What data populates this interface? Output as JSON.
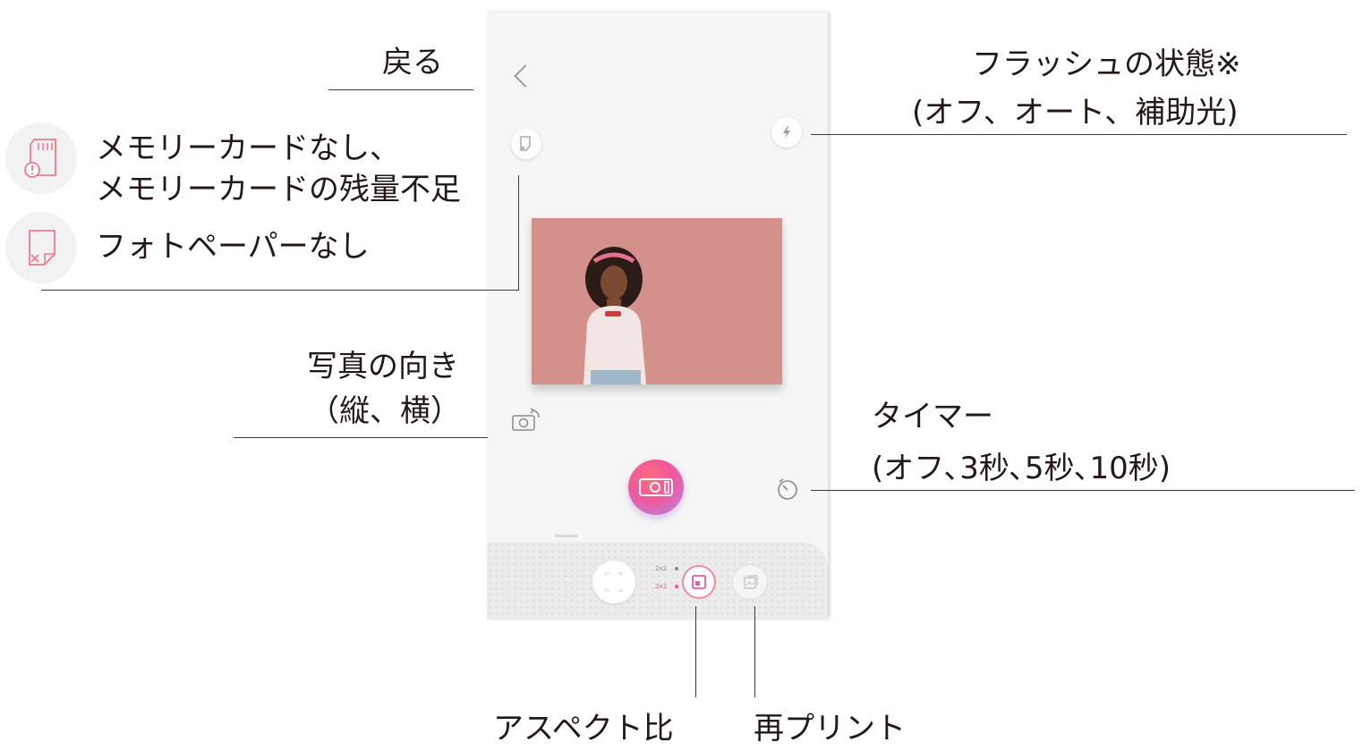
{
  "callouts": {
    "back": "戻る",
    "flash_title": "フラッシュの状態※",
    "flash_options": "(オフ、オート、補助光)",
    "memory_card_line1": "メモリーカードなし、",
    "memory_card_line2": "メモリーカードの残量不足",
    "no_photo_paper": "フォトペーパーなし",
    "orientation_title": "写真の向き",
    "orientation_options": "（縦、横）",
    "timer_title": "タイマー",
    "timer_options": "(オフ､3秒､5秒､10秒)",
    "aspect_ratio": "アスペクト比",
    "reprint": "再プリント"
  },
  "screen": {
    "ratio_options": [
      "2x2",
      "2x3"
    ],
    "selected_ratio": "2x3"
  },
  "colors": {
    "accent_pink": "#f0589c",
    "alert_pink": "#f07a8e",
    "photo_background": "#d4918b"
  },
  "icons": {
    "back": "chevron-left-icon",
    "paper_status": "photo-paper-icon",
    "flash": "lightning-icon",
    "orientation": "camera-rotate-icon",
    "timer": "timer-icon",
    "shutter": "camera-icon",
    "aspect": "aspect-ratio-icon",
    "reprint": "reprint-icon",
    "memory_card_alert": "sd-card-alert-icon",
    "no_paper": "no-paper-icon"
  }
}
